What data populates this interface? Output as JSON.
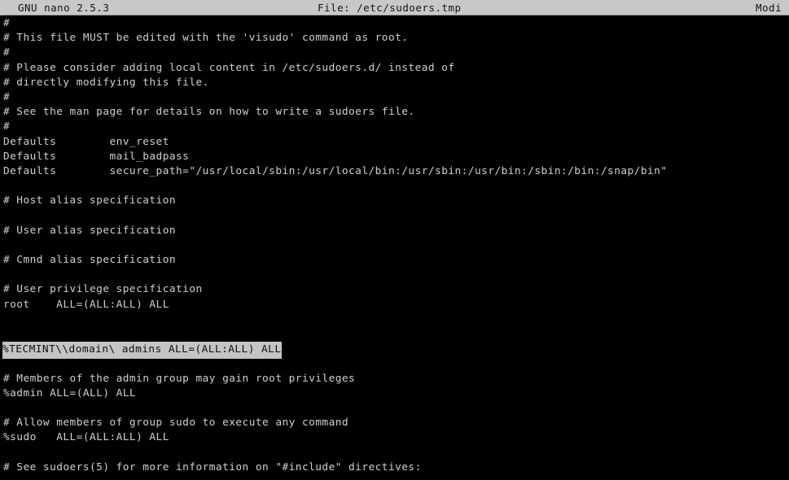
{
  "window": {
    "app_name": "GNU nano",
    "app_version": "2.5.3",
    "background_color": "#000000",
    "foreground_color": "#d0d0d0"
  },
  "title_bar": {
    "background_color": "#c8c8c8",
    "text_color": "#141414",
    "version_label": "GNU nano 2.5.3",
    "file_label": "File: /etc/sudoers.tmp",
    "modified_label": "Modi"
  },
  "editor": {
    "file_path": "/etc/sudoers.tmp",
    "highlight_background_color": "#c4c4c4",
    "highlight_text_color": "#101010",
    "highlighted_line_index": 22,
    "lines": [
      {
        "text": "#"
      },
      {
        "text": "# This file MUST be edited with the 'visudo' command as root."
      },
      {
        "text": "#"
      },
      {
        "text": "# Please consider adding local content in /etc/sudoers.d/ instead of"
      },
      {
        "text": "# directly modifying this file."
      },
      {
        "text": "#"
      },
      {
        "text": "# See the man page for details on how to write a sudoers file."
      },
      {
        "text": "#"
      },
      {
        "text": "Defaults        env_reset"
      },
      {
        "text": "Defaults        mail_badpass"
      },
      {
        "text": "Defaults        secure_path=\"/usr/local/sbin:/usr/local/bin:/usr/sbin:/usr/bin:/sbin:/bin:/snap/bin\""
      },
      {
        "text": ""
      },
      {
        "text": "# Host alias specification"
      },
      {
        "text": ""
      },
      {
        "text": "# User alias specification"
      },
      {
        "text": ""
      },
      {
        "text": "# Cmnd alias specification"
      },
      {
        "text": ""
      },
      {
        "text": "# User privilege specification"
      },
      {
        "text": "root    ALL=(ALL:ALL) ALL"
      },
      {
        "text": ""
      },
      {
        "text": ""
      },
      {
        "text": "%TECMINT\\\\domain\\ admins ALL=(ALL:ALL) ALL",
        "highlighted": true
      },
      {
        "text": ""
      },
      {
        "text": "# Members of the admin group may gain root privileges"
      },
      {
        "text": "%admin ALL=(ALL) ALL"
      },
      {
        "text": ""
      },
      {
        "text": "# Allow members of group sudo to execute any command"
      },
      {
        "text": "%sudo   ALL=(ALL:ALL) ALL"
      },
      {
        "text": ""
      },
      {
        "text": "# See sudoers(5) for more information on \"#include\" directives:"
      }
    ]
  }
}
